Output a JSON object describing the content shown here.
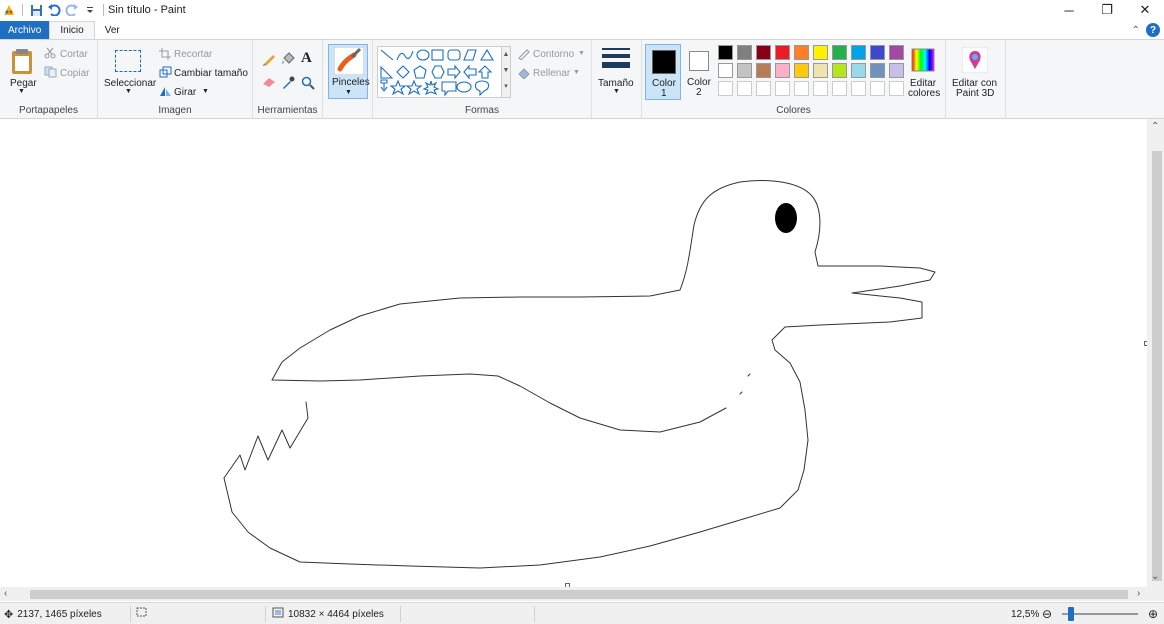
{
  "window": {
    "title": "Sin título - Paint",
    "minimize": "─",
    "restore": "❐",
    "close": "✕"
  },
  "tabs": {
    "file": "Archivo",
    "home": "Inicio",
    "view": "Ver"
  },
  "ribbon": {
    "clipboard": {
      "paste": "Pegar",
      "cut": "Cortar",
      "copy": "Copiar",
      "group": "Portapapeles"
    },
    "image": {
      "select": "Seleccionar",
      "crop": "Recortar",
      "resize": "Cambiar tamaño",
      "rotate": "Girar",
      "group": "Imagen"
    },
    "tools": {
      "group": "Herramientas"
    },
    "brushes": {
      "label": "Pinceles"
    },
    "shapes": {
      "outline": "Contorno",
      "fill": "Rellenar",
      "group": "Formas"
    },
    "size": {
      "label": "Tamaño"
    },
    "colors": {
      "color1": "Color",
      "color1_num": "1",
      "color2": "Color",
      "color2_num": "2",
      "edit": "Editar",
      "edit2": "colores",
      "group": "Colores",
      "palette_row1": [
        "#000000",
        "#7f7f7f",
        "#880015",
        "#ed1c24",
        "#ff7f27",
        "#fff200",
        "#22b14c",
        "#00a2e8",
        "#3f48cc",
        "#a349a4"
      ],
      "palette_row2": [
        "#ffffff",
        "#c3c3c3",
        "#b97a57",
        "#ffaec9",
        "#ffc90e",
        "#efe4b0",
        "#b5e61d",
        "#99d9ea",
        "#7092be",
        "#c8bfe7"
      ]
    },
    "paint3d": {
      "line1": "Editar con",
      "line2": "Paint 3D"
    }
  },
  "status": {
    "cursor": "2137, 1465 píxeles",
    "image_size": "10832 × 4464 píxeles",
    "zoom": "12,5%"
  }
}
